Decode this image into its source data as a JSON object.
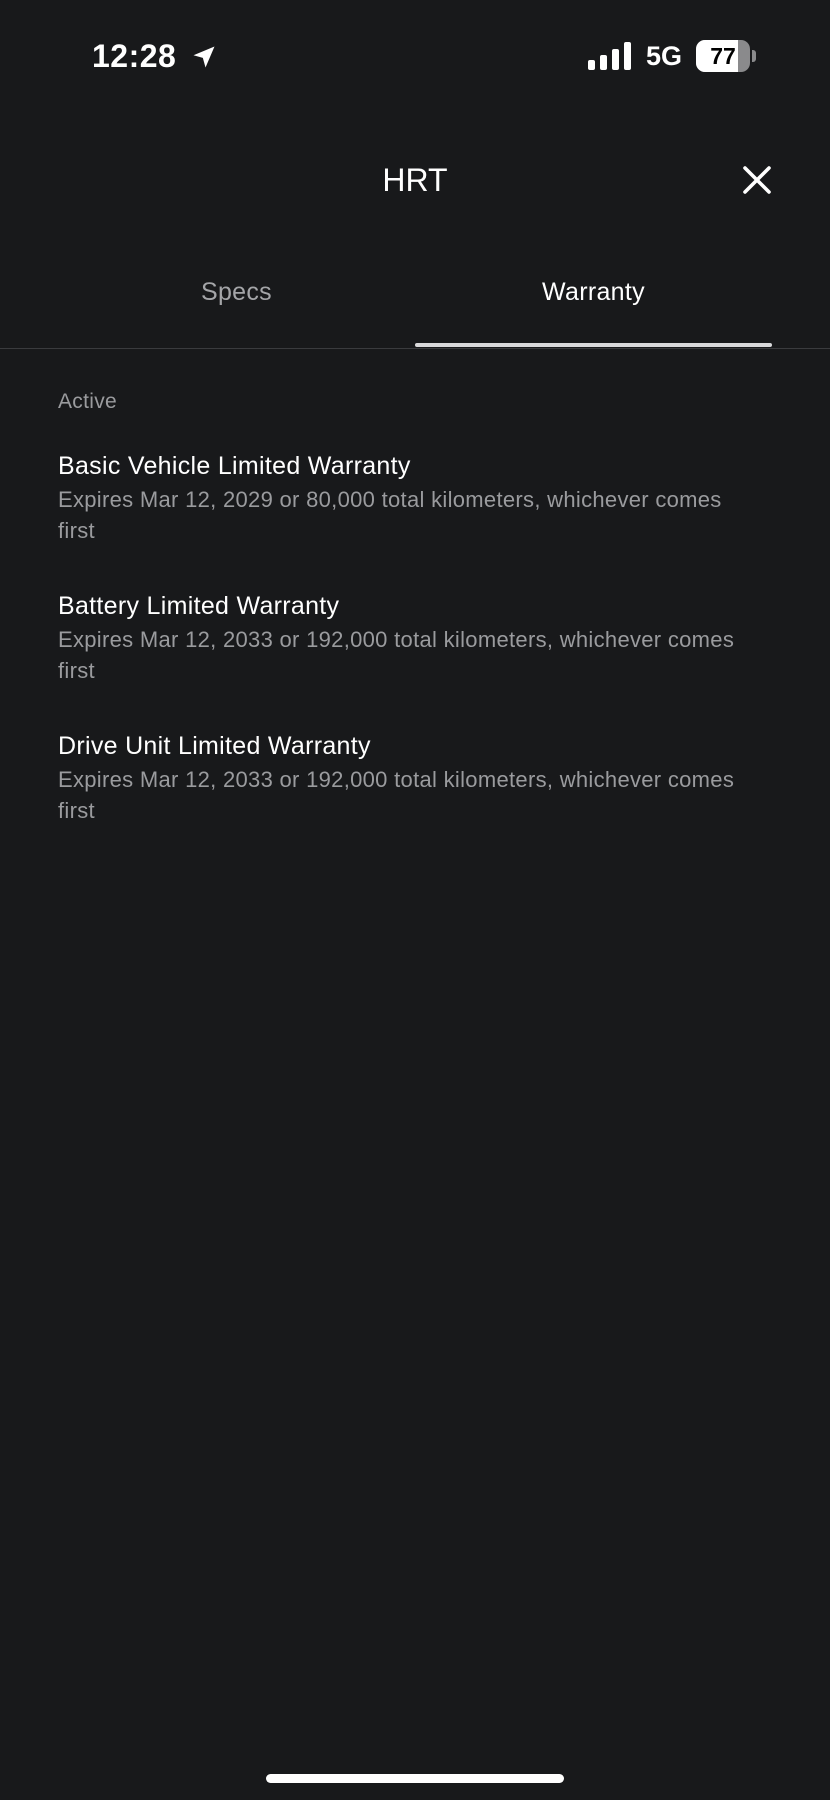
{
  "status_bar": {
    "time": "12:28",
    "network": "5G",
    "battery_level": "77",
    "battery_fraction": 0.77,
    "icons": [
      "location-arrow-icon",
      "signal-bars-icon",
      "battery-icon"
    ]
  },
  "header": {
    "title": "HRT",
    "close_icon": "close-icon"
  },
  "tabs": [
    {
      "label": "Specs",
      "active": false
    },
    {
      "label": "Warranty",
      "active": true
    }
  ],
  "warranty": {
    "section_label": "Active",
    "items": [
      {
        "title": "Basic Vehicle Limited Warranty",
        "detail": "Expires Mar 12, 2029 or 80,000 total kilometers, whichever comes first"
      },
      {
        "title": "Battery Limited Warranty",
        "detail": "Expires Mar 12, 2033 or 192,000 total kilometers, whichever comes first"
      },
      {
        "title": "Drive Unit Limited Warranty",
        "detail": "Expires Mar 12, 2033 or 192,000 total kilometers, whichever comes first"
      }
    ]
  },
  "colors": {
    "background": "#18191b",
    "primary_text": "#ffffff",
    "secondary_text": "#9a9b9e",
    "inactive_tab": "#a4a5a8",
    "divider": "#3a3b3e",
    "tab_indicator": "#d9d9db"
  }
}
